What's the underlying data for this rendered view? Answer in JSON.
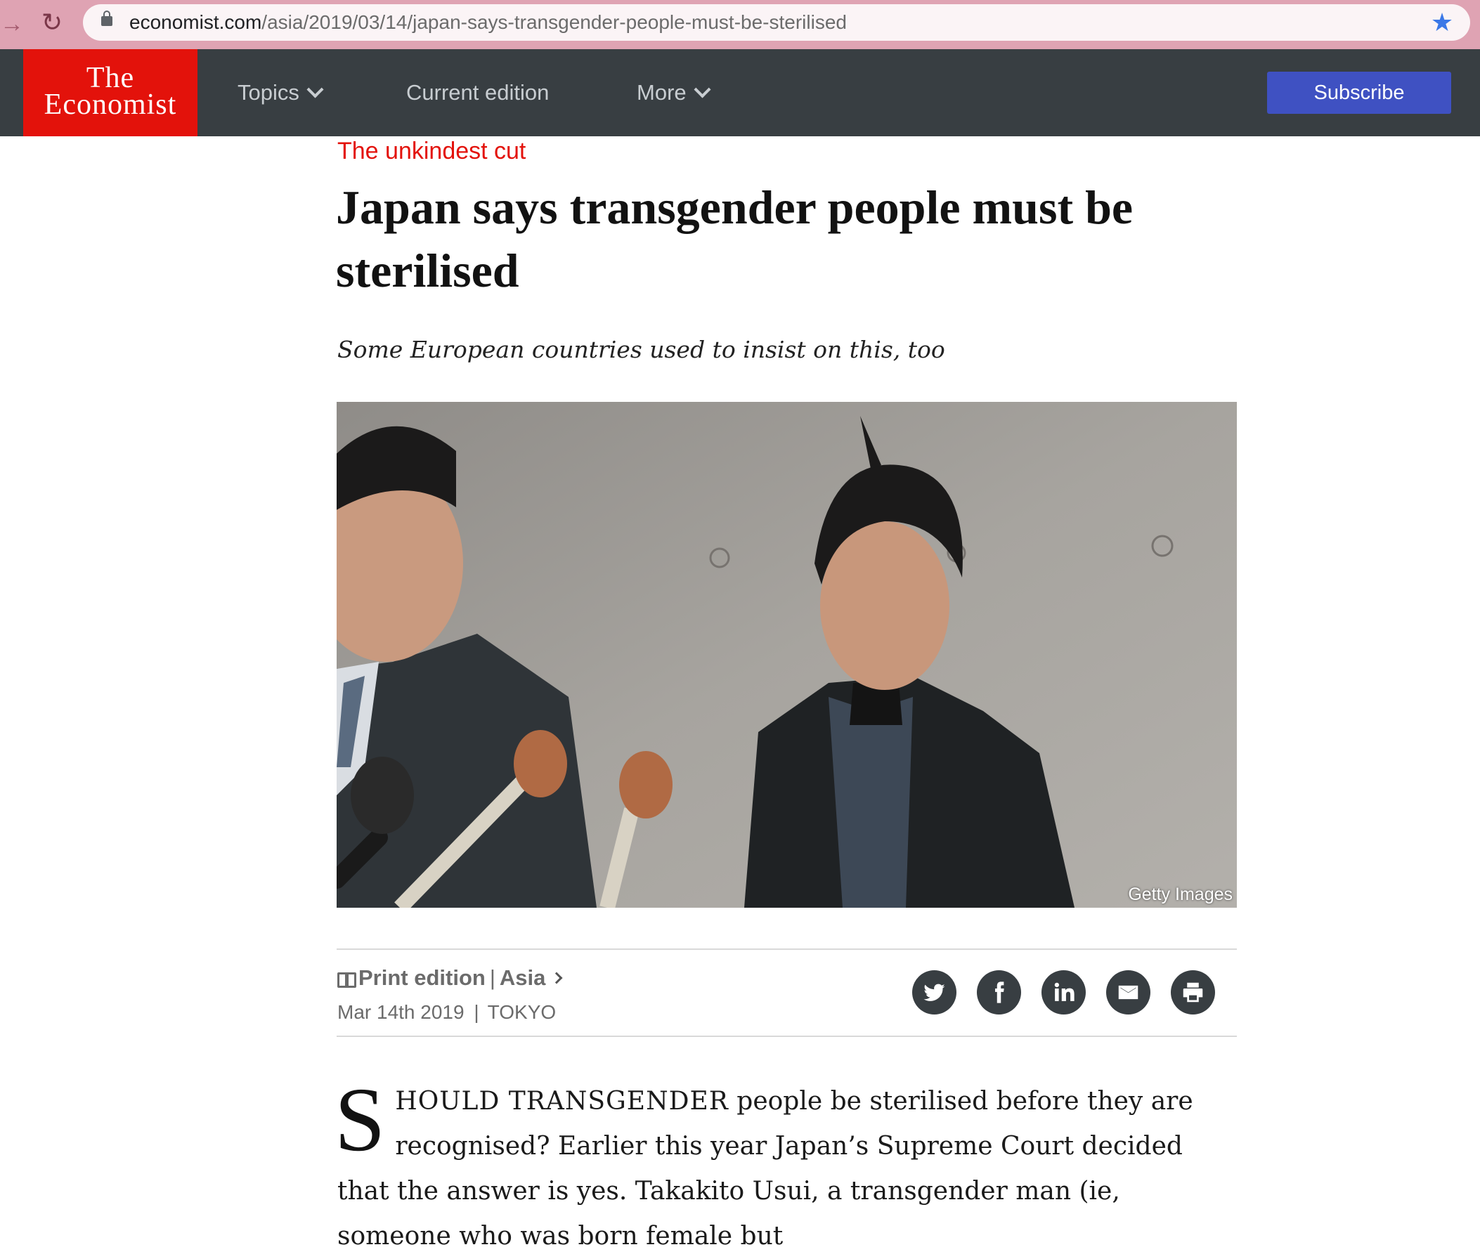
{
  "browser": {
    "url_host": "economist.com",
    "url_path": "/asia/2019/03/14/japan-says-transgender-people-must-be-sterilised"
  },
  "header": {
    "logo_line1": "The",
    "logo_line2": "Economist",
    "nav": {
      "topics": "Topics",
      "current_edition": "Current edition",
      "more": "More"
    },
    "subscribe": "Subscribe"
  },
  "article": {
    "rubric": "The unkindest cut",
    "headline": "Japan says transgender people must be sterilised",
    "subhead": "Some European countries used to insist on this, too",
    "image_credit": "Getty Images",
    "print_edition": "Print edition",
    "section": "Asia",
    "date": "Mar 14th 2019",
    "dateline": "TOKYO",
    "body": {
      "drop_cap": "S",
      "lead_smallcaps": "HOULD TRANSGENDER",
      "line1_rest": " people be sterilised before they are recognised? Earlier this year Japan’s Supreme Court decided that the answer is yes. Takakito Usui, a transgender man (ie, someone who was born female but"
    }
  },
  "share": {
    "twitter_icon": "twitter-icon",
    "facebook_icon": "facebook-icon",
    "linkedin_icon": "linkedin-icon",
    "email_icon": "email-icon",
    "print_icon": "print-icon"
  }
}
